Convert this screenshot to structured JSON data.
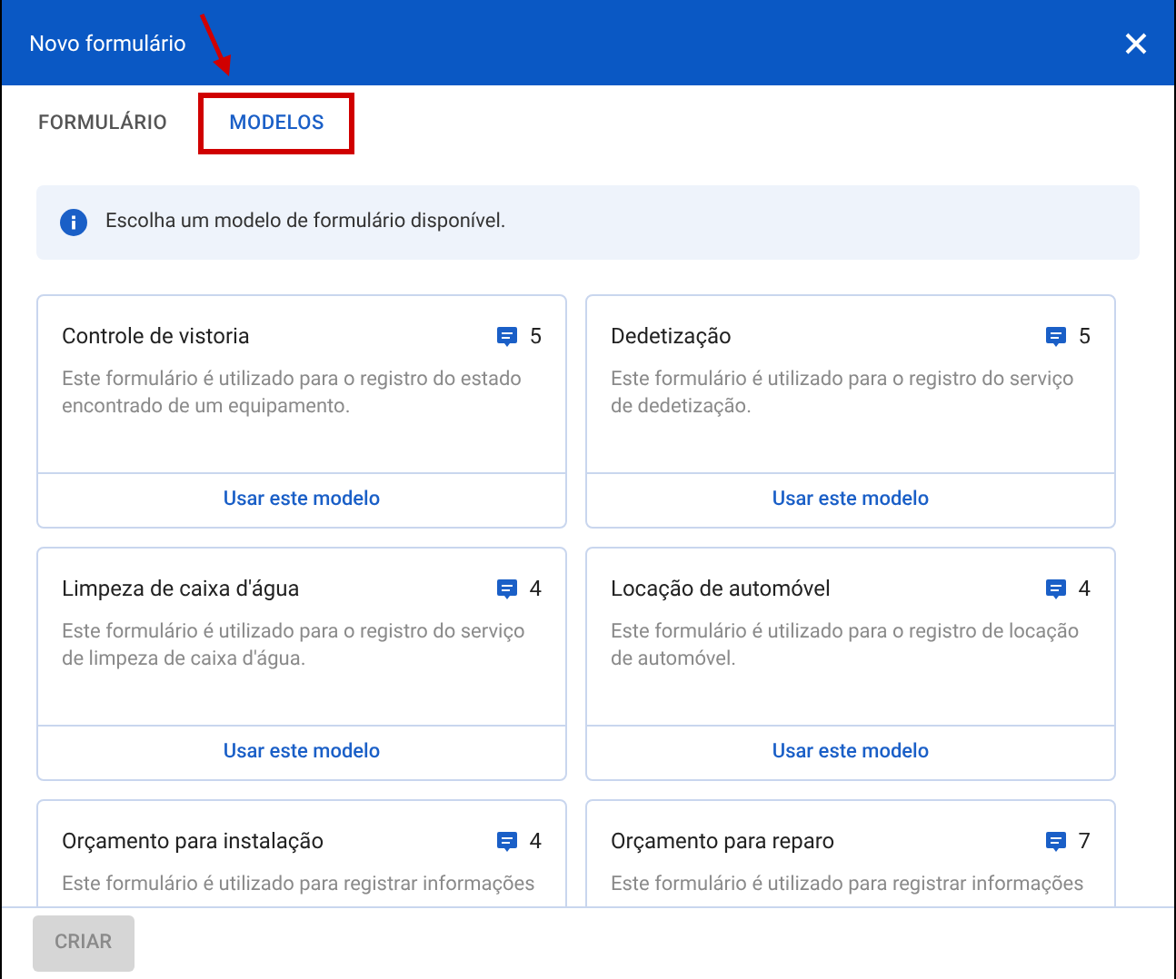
{
  "window": {
    "title": "Novo formulário"
  },
  "tabs": [
    {
      "label": "FORMULÁRIO",
      "selected": false,
      "highlighted": false
    },
    {
      "label": "MODELOS",
      "selected": true,
      "highlighted": true
    }
  ],
  "info": "Escolha um modelo de formulário disponível.",
  "templates": [
    {
      "title": "Controle de vistoria",
      "count": "5",
      "description": "Este formulário é utilizado para o registro do estado encontrado de um equipamento.",
      "action": "Usar este modelo"
    },
    {
      "title": "Dedetização",
      "count": "5",
      "description": "Este formulário é utilizado para o registro do serviço de dedetização.",
      "action": "Usar este modelo"
    },
    {
      "title": "Limpeza de caixa d'água",
      "count": "4",
      "description": "Este formulário é utilizado para o registro do serviço de limpeza de caixa d'água.",
      "action": "Usar este modelo"
    },
    {
      "title": "Locação de automóvel",
      "count": "4",
      "description": "Este formulário é utilizado para o registro de locação de automóvel.",
      "action": "Usar este modelo"
    },
    {
      "title": "Orçamento para instalação",
      "count": "4",
      "description": "Este formulário é utilizado para registrar informações"
    },
    {
      "title": "Orçamento para reparo",
      "count": "7",
      "description": "Este formulário é utilizado para registrar informações"
    }
  ],
  "footer": {
    "button": {
      "label": "CRIAR",
      "disabled": true
    }
  }
}
